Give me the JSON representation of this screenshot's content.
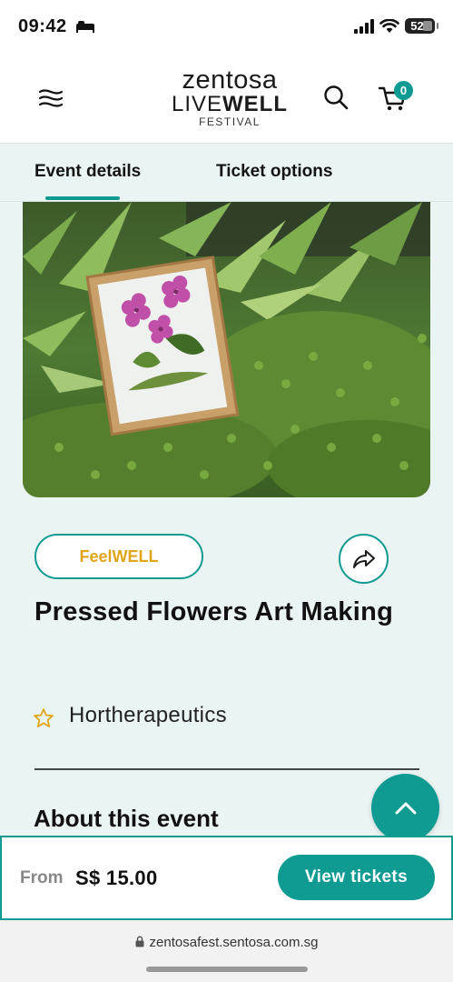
{
  "status_bar": {
    "time": "09:42",
    "battery": "52"
  },
  "header": {
    "logo_line1": "zentosa",
    "logo_live": "LIVE",
    "logo_well": "WELL",
    "logo_line3": "FESTIVAL",
    "cart_count": "0"
  },
  "tabs": [
    {
      "label": "Event details",
      "active": true
    },
    {
      "label": "Ticket options",
      "active": false
    }
  ],
  "event": {
    "category": "FeelWELL",
    "title": "Pressed Flowers Art Making",
    "host": "Hortherapeutics",
    "about_heading": "About this event"
  },
  "purchase": {
    "from_label": "From",
    "price": "S$ 15.00",
    "cta_label": "View tickets"
  },
  "browser": {
    "url": "zentosafest.sentosa.com.sg"
  },
  "colors": {
    "accent": "#0f9a92",
    "category_text": "#e0a51a",
    "page_bg": "#eaf4f2"
  },
  "icons": [
    "menu-icon",
    "search-icon",
    "cart-icon",
    "share-icon",
    "star-icon",
    "chevron-up-icon",
    "lock-icon"
  ]
}
